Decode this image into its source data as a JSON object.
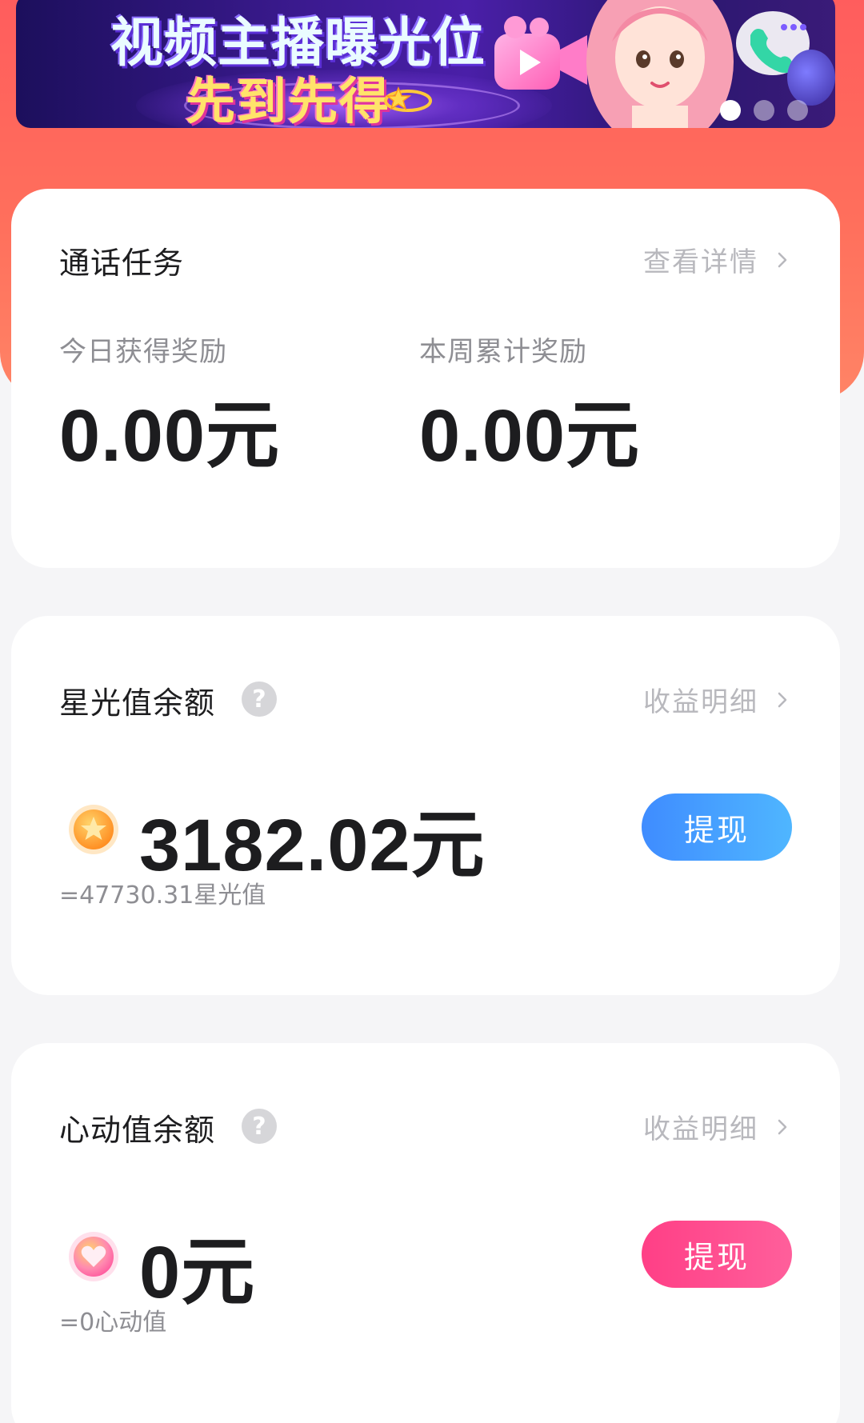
{
  "banner": {
    "line1": "视频主播曝光位",
    "line2": "先到先得",
    "page_dots": 3,
    "active_dot": 1
  },
  "call_task": {
    "title": "通话任务",
    "link": "查看详情",
    "today_label": "今日获得奖励",
    "today_value": "0.00元",
    "week_label": "本周累计奖励",
    "week_value": "0.00元"
  },
  "starlight": {
    "title": "星光值余额",
    "help": "?",
    "link": "收益明细",
    "amount": "3182.02元",
    "equivalent": "=47730.31星光值",
    "withdraw": "提现",
    "icon": "star-coin-icon",
    "accent": "#3f8cff"
  },
  "heartbeat": {
    "title": "心动值余额",
    "help": "?",
    "link": "收益明细",
    "amount": "0元",
    "equivalent": "=0心动值",
    "withdraw": "提现",
    "icon": "heart-coin-icon",
    "accent": "#ff3f86"
  }
}
